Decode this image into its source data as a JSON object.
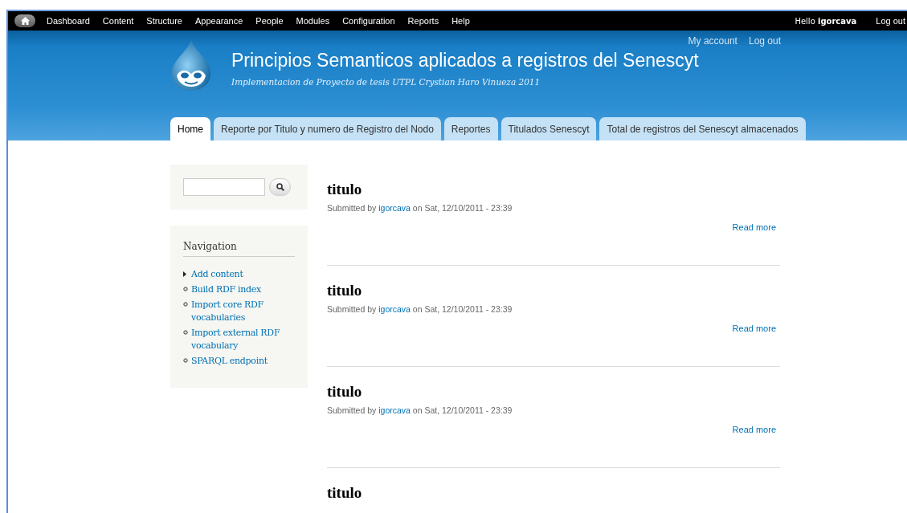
{
  "toolbar": {
    "items": [
      "Dashboard",
      "Content",
      "Structure",
      "Appearance",
      "People",
      "Modules",
      "Configuration",
      "Reports",
      "Help"
    ],
    "greeting": "Hello **igorcava**",
    "logout": "Log out"
  },
  "header": {
    "site_name": "Principios Semanticos aplicados a registros del Senescyt",
    "slogan": "Implementacion de Proyecto de tesis UTPL Crystian Haro Vinueza 2011",
    "secondary_menu": [
      "My account",
      "Log out"
    ],
    "tabs": [
      {
        "label": "Home",
        "selected": true
      },
      {
        "label": "Reporte por Titulo y numero de Registro del Nodo",
        "selected": false
      },
      {
        "label": "Reportes",
        "selected": false
      },
      {
        "label": "Titulados Senescyt",
        "selected": false
      },
      {
        "label": "Total de registros del Senescyt almacenados",
        "selected": false
      }
    ]
  },
  "sidebar": {
    "navigation": {
      "title": "Navigation",
      "items": [
        {
          "label": "Add content",
          "kind": "collapsed"
        },
        {
          "label": "Build RDF index",
          "kind": "leaf"
        },
        {
          "label": "Import core RDF vocabularies",
          "kind": "leaf"
        },
        {
          "label": "Import external RDF vocabulary",
          "kind": "leaf"
        },
        {
          "label": "SPARQL endpoint",
          "kind": "leaf"
        }
      ]
    }
  },
  "posts": [
    {
      "title": "titulo",
      "submitted_by": "Submitted by",
      "author": "igorcava",
      "date": "on Sat, 12/10/2011 - 23:39",
      "read_more": "Read more"
    },
    {
      "title": "titulo",
      "submitted_by": "Submitted by",
      "author": "igorcava",
      "date": "on Sat, 12/10/2011 - 23:39",
      "read_more": "Read more"
    },
    {
      "title": "titulo",
      "submitted_by": "Submitted by",
      "author": "igorcava",
      "date": "on Sat, 12/10/2011 - 23:39",
      "read_more": "Read more"
    },
    {
      "title": "titulo"
    }
  ]
}
